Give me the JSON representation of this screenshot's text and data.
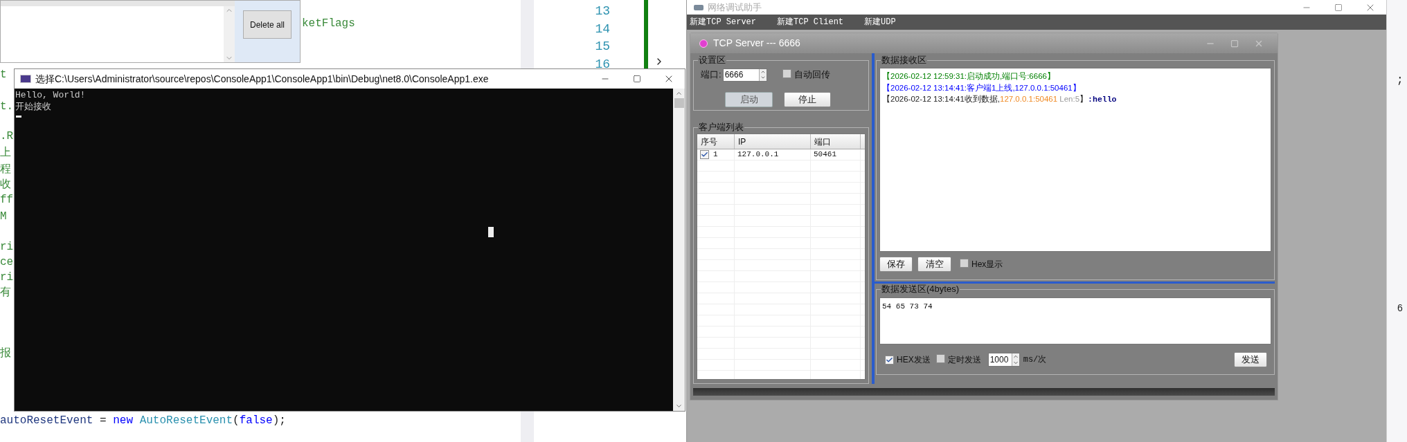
{
  "editor": {
    "margin_fragments": [
      "t",
      "t.",
      ".R",
      "上",
      "程",
      "收",
      "ff",
      "M",
      "ri",
      "ce",
      "ri",
      "有",
      "报"
    ],
    "code_tail": "ketFlags",
    "line_numbers": [
      "13",
      "14",
      "15",
      "16"
    ],
    "bottom_line": [
      {
        "kind": "identifier",
        "text": "autoResetEvent"
      },
      {
        "kind": "plain",
        "text": " = "
      },
      {
        "kind": "keyword",
        "text": "new"
      },
      {
        "kind": "type",
        "text": " AutoResetEvent"
      },
      {
        "kind": "plain",
        "text": "("
      },
      {
        "kind": "keyword",
        "text": "false"
      },
      {
        "kind": "plain",
        "text": ");"
      }
    ],
    "right_fragments": [
      ";",
      "6"
    ]
  },
  "dialog": {
    "delete_button": "Delete all"
  },
  "console": {
    "title": "选择C:\\Users\\Administrator\\source\\repos\\ConsoleApp1\\ConsoleApp1\\bin\\Debug\\net8.0\\ConsoleApp1.exe",
    "lines": [
      "Hello, World!",
      "开始接收"
    ]
  },
  "net_tool": {
    "title": "网络调试助手",
    "menu": [
      "新建TCP Server",
      "新建TCP Client",
      "新建UDP"
    ],
    "server": {
      "title": "TCP Server --- 6666",
      "settings": {
        "legend": "设置区",
        "port_label": "端口:",
        "port": "6666",
        "auto_reply": {
          "label": "自动回传",
          "checked": false
        },
        "start": {
          "label": "启动",
          "disabled": true
        },
        "stop": {
          "label": "停止",
          "disabled": false
        }
      },
      "clients": {
        "legend": "客户端列表",
        "columns": [
          "序号",
          "IP",
          "端口"
        ],
        "rows": [
          {
            "checked": true,
            "cells": [
              "1",
              "127.0.0.1",
              "50461"
            ]
          }
        ]
      },
      "receive": {
        "legend": "数据接收区",
        "lines": [
          [
            {
              "text": "【2026-02-12 12:59:31:启动成功,端口号:6666】",
              "color": "#008000"
            }
          ],
          [
            {
              "text": "【2026-02-12 13:14:41:客户端1上线,127.0.0.1:50461】",
              "color": "#0000ff"
            }
          ],
          [
            {
              "text": "【2026-02-12 13:14:41收到数据,",
              "color": "#222222"
            },
            {
              "text": "127.0.0.1:50461",
              "color": "#f08a24"
            },
            {
              "text": " Len:5",
              "color": "#999999"
            },
            {
              "text": "】",
              "color": "#222222"
            },
            {
              "text": ":hello",
              "color": "#00007f",
              "bold": true
            }
          ]
        ],
        "save": "保存",
        "clear": "清空",
        "hex_display": {
          "label": "Hex显示",
          "checked": false
        }
      },
      "send": {
        "legend": "数据发送区(4bytes)",
        "value": "54 65 73 74",
        "hex_send": {
          "label": "HEX发送",
          "checked": true
        },
        "timed_send": {
          "label": "定时发送",
          "checked": false
        },
        "interval": "1000",
        "unit": "ms/次",
        "send": "发送"
      }
    }
  }
}
